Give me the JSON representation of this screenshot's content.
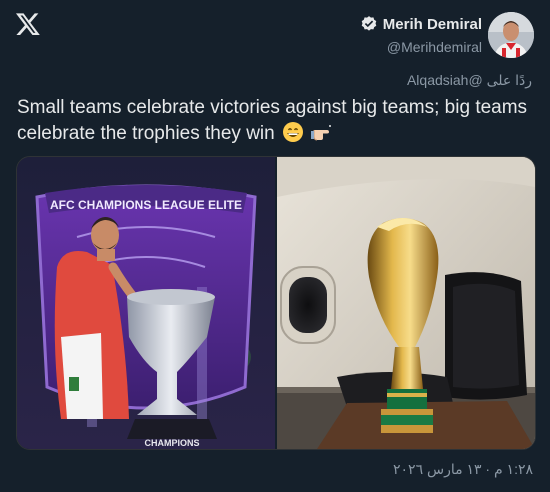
{
  "author": {
    "name": "Merih Demiral",
    "handle": "@Merihdemiral",
    "verified": true
  },
  "reply_to": {
    "prefix": "ردًا على",
    "handle": "@Alqadsiah"
  },
  "tweet": {
    "text": "Small teams celebrate victories against big teams; big teams celebrate the trophies they win",
    "emojis": [
      "grinning-face-emoji",
      "pointing-hand-emoji"
    ]
  },
  "media": {
    "left_banner": "AFC CHAMPIONS LEAGUE ELITE",
    "left_base_label": "CHAMPIONS"
  },
  "timestamp": "١:٢٨ م · ١٣ مارس ٢٠٢٦",
  "colors": {
    "background": "#15202b",
    "text": "#e7e9ea",
    "muted": "#8b98a5"
  }
}
